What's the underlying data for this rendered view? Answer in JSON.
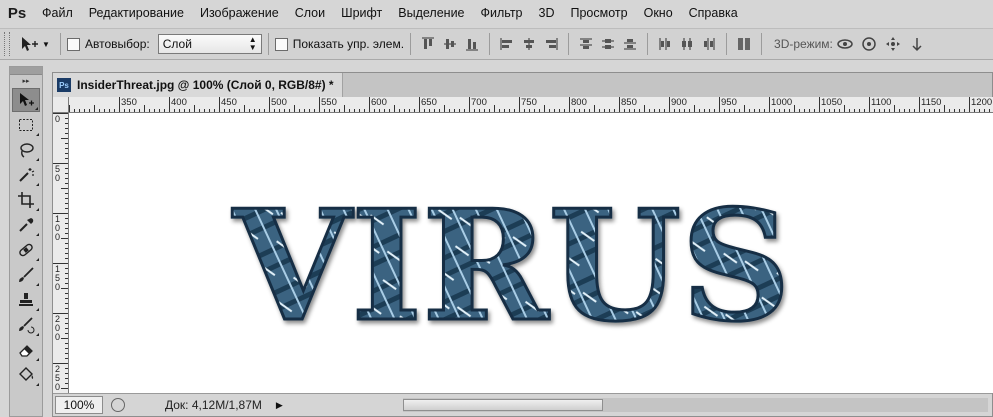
{
  "app": {
    "logo": "Ps",
    "menu": [
      "Файл",
      "Редактирование",
      "Изображение",
      "Слои",
      "Шрифт",
      "Выделение",
      "Фильтр",
      "3D",
      "Просмотр",
      "Окно",
      "Справка"
    ]
  },
  "options": {
    "auto_select_label": "Автовыбор:",
    "layer_select_value": "Слой",
    "show_transform_label": "Показать упр. элем.",
    "mode_3d_label": "3D-режим:"
  },
  "toolbox": {
    "tools": [
      "move-tool",
      "marquee-tool",
      "lasso-tool",
      "quick-select-tool",
      "crop-tool",
      "eyedropper-tool",
      "healing-brush-tool",
      "brush-tool",
      "clone-stamp-tool",
      "history-brush-tool",
      "eraser-tool",
      "paint-bucket-tool"
    ]
  },
  "document": {
    "tab_title": "InsiderThreat.jpg @ 100% (Слой 0, RGB/8#) *",
    "ruler_top_labels": [
      "350",
      "400",
      "450",
      "500",
      "550",
      "600",
      "650",
      "700",
      "750",
      "800",
      "850",
      "900",
      "950",
      "1000",
      "1050",
      "1100",
      "1150",
      "1200"
    ],
    "ruler_left_labels": [
      "0",
      "50",
      "100",
      "150",
      "200",
      "250"
    ],
    "canvas_text": "VIRUS",
    "zoom": "100%",
    "doc_size": "Док: 4,12M/1,87M"
  },
  "colors": {
    "letter_fill": "#3a6381",
    "letter_dark": "#1f3c55",
    "letter_light": "#a9cde6",
    "ui_bg": "#d6d6d6"
  }
}
